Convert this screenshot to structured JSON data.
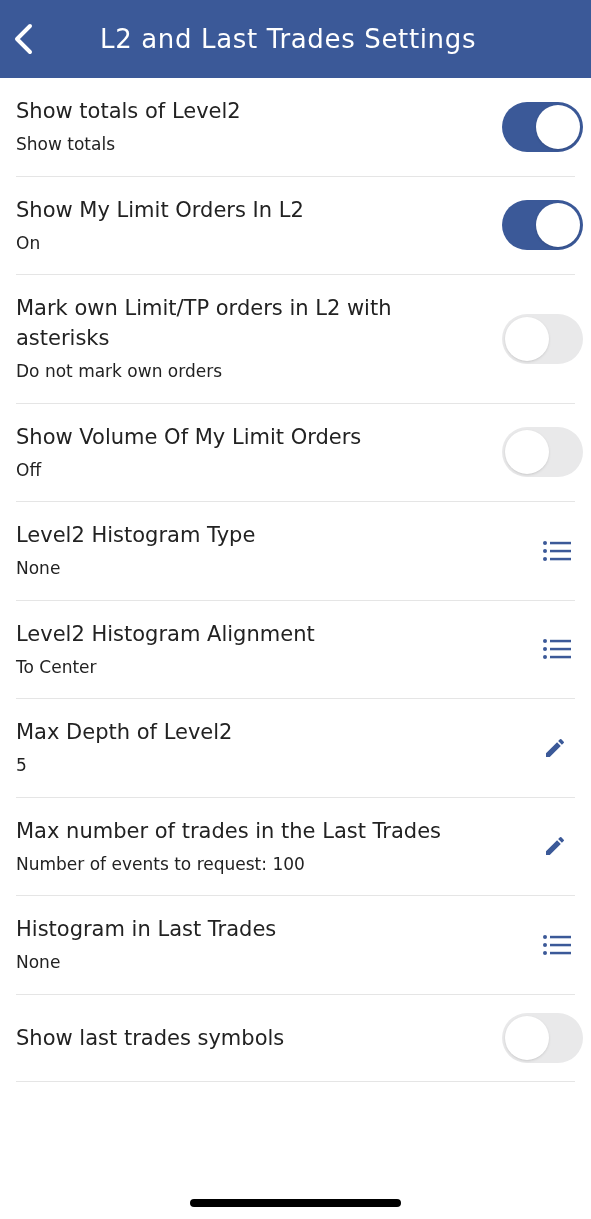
{
  "header": {
    "title": "L2 and Last Trades Settings"
  },
  "settings": [
    {
      "kind": "toggle",
      "title": "Show totals of Level2",
      "subtitle": "Show totals",
      "on": true
    },
    {
      "kind": "toggle",
      "title": "Show My Limit Orders In L2",
      "subtitle": "On",
      "on": true
    },
    {
      "kind": "toggle",
      "title": "Mark own Limit/TP orders in L2 with asterisks",
      "subtitle": "Do not mark own orders",
      "on": false
    },
    {
      "kind": "toggle",
      "title": "Show Volume Of My Limit Orders",
      "subtitle": "Off",
      "on": false
    },
    {
      "kind": "list",
      "title": "Level2 Histogram Type",
      "subtitle": "None"
    },
    {
      "kind": "list",
      "title": "Level2 Histogram Alignment",
      "subtitle": "To Center"
    },
    {
      "kind": "edit",
      "title": "Max Depth of Level2",
      "subtitle": "5"
    },
    {
      "kind": "edit",
      "title": "Max number of trades in the Last Trades",
      "subtitle": "Number of events to request: 100"
    },
    {
      "kind": "list",
      "title": "Histogram in Last Trades",
      "subtitle": "None"
    },
    {
      "kind": "toggle",
      "title": "Show last trades symbols",
      "on": false
    }
  ]
}
